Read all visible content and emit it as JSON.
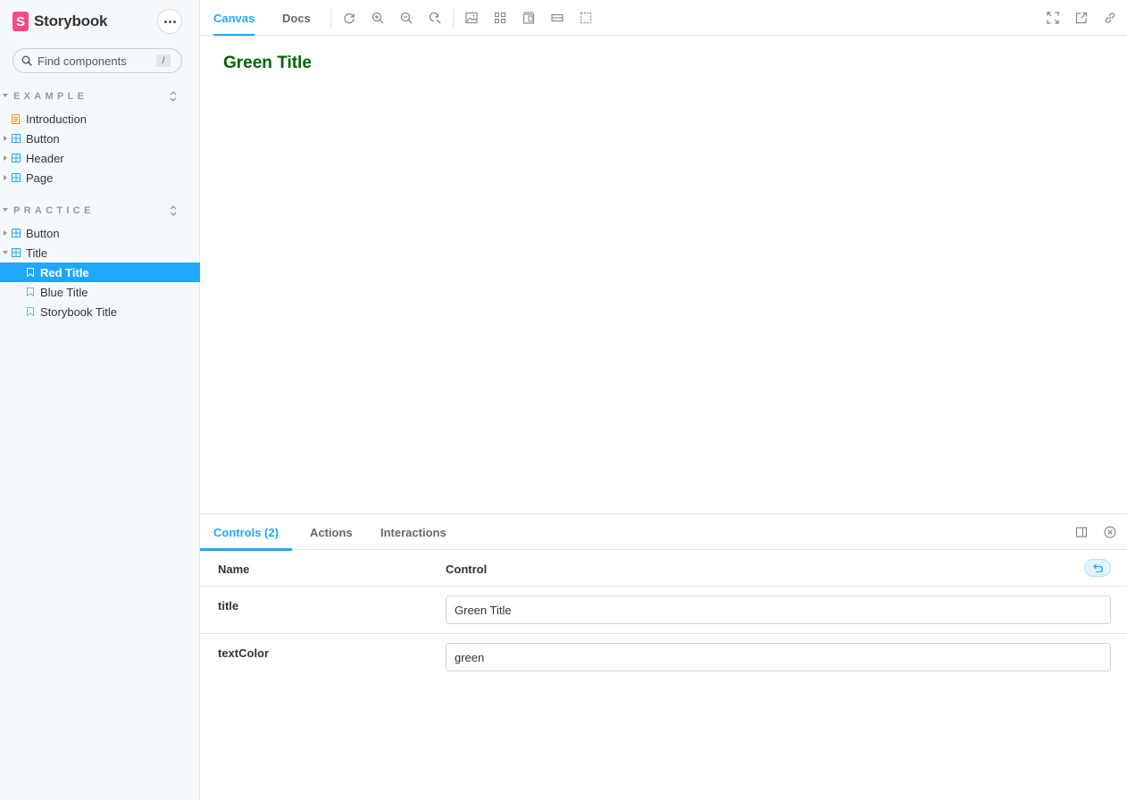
{
  "brand": {
    "logo_letter": "S",
    "name": "Storybook"
  },
  "search": {
    "placeholder": "Find components",
    "shortcut": "/"
  },
  "sidebar": {
    "groups": [
      {
        "label": "EXAMPLE",
        "items": [
          {
            "label": "Introduction",
            "icon": "document-icon",
            "color": "#ff8800"
          },
          {
            "label": "Button",
            "icon": "component-icon",
            "color": "#1ea7fd"
          },
          {
            "label": "Header",
            "icon": "component-icon",
            "color": "#1ea7fd"
          },
          {
            "label": "Page",
            "icon": "component-icon",
            "color": "#1ea7fd"
          }
        ]
      },
      {
        "label": "PRACTICE",
        "items": [
          {
            "label": "Button",
            "icon": "component-icon",
            "color": "#1ea7fd"
          },
          {
            "label": "Title",
            "icon": "component-icon",
            "color": "#1ea7fd"
          },
          {
            "label": "Red Title",
            "icon": "bookmark-icon",
            "color": "#37d5d3",
            "selected": true
          },
          {
            "label": "Blue Title",
            "icon": "bookmark-icon",
            "color": "#37d5d3"
          },
          {
            "label": "Storybook Title",
            "icon": "bookmark-icon",
            "color": "#37d5d3"
          }
        ]
      }
    ]
  },
  "toolbar": {
    "tabs": [
      "Canvas",
      "Docs"
    ],
    "active_tab": "Canvas"
  },
  "preview": {
    "title": "Green Title",
    "title_color": "#006400"
  },
  "addons": {
    "tabs": [
      "Controls (2)",
      "Actions",
      "Interactions"
    ],
    "active_tab": "Controls (2)",
    "headers": {
      "name": "Name",
      "control": "Control"
    },
    "rows": [
      {
        "name": "title",
        "value": "Green Title"
      },
      {
        "name": "textColor",
        "value": "green"
      }
    ]
  },
  "colors": {
    "accent": "#1ea7fd",
    "brand": "#ff4785",
    "sidebar_bg": "#f6f9fc"
  }
}
